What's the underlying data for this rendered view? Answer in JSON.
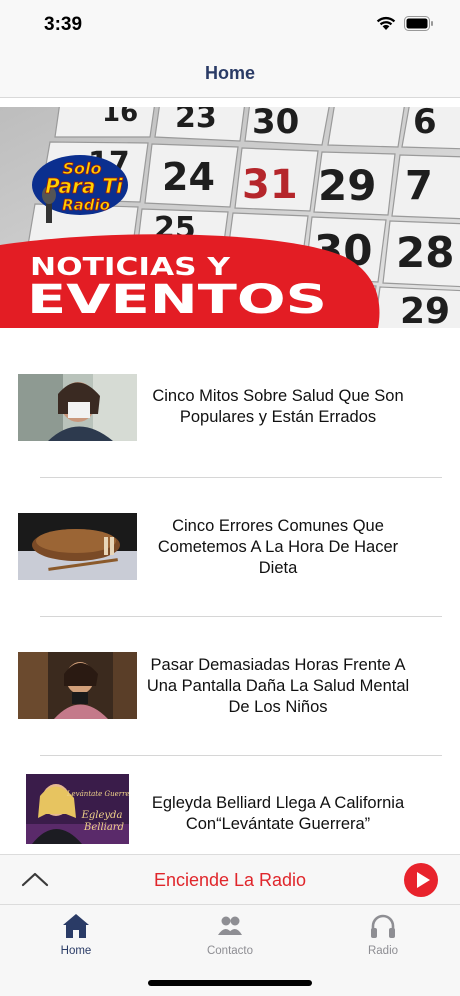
{
  "status_bar": {
    "time": "3:39"
  },
  "nav": {
    "title": "Home"
  },
  "banner": {
    "logo_text": [
      "Solo",
      "Para Ti",
      "Radio"
    ],
    "headline_line1": "NOTICIAS Y",
    "headline_line2": "EVENTOS",
    "calendar_numbers": [
      "16",
      "23",
      "30",
      "24",
      "31",
      "29",
      "30",
      "28",
      "17",
      "7",
      "6",
      "25",
      "29"
    ]
  },
  "news": [
    {
      "title": "Cinco Mitos Sobre Salud Que Son Populares y Están Errados"
    },
    {
      "title": "Cinco Errores Comunes Que Cometemos A La Hora De Hacer Dieta"
    },
    {
      "title": "Pasar Demasiadas Horas Frente A Una Pantalla Daña La Salud Mental De Los Niños"
    },
    {
      "title": "Egleyda Belliard Llega A California Con“Levántate Guerrera”",
      "thumb_text": [
        "Levántate Guerrera",
        "Egleyda",
        "Belliard"
      ]
    }
  ],
  "radio_bar": {
    "label": "Enciende La Radio"
  },
  "tabs": [
    {
      "label": "Home",
      "icon": "home-icon",
      "active": true
    },
    {
      "label": "Contacto",
      "icon": "contacts-icon",
      "active": false
    },
    {
      "label": "Radio",
      "icon": "headphones-icon",
      "active": false
    }
  ],
  "colors": {
    "accent_navy": "#2a3b66",
    "radio_red": "#e0262b",
    "inactive_gray": "#8e8e93"
  }
}
